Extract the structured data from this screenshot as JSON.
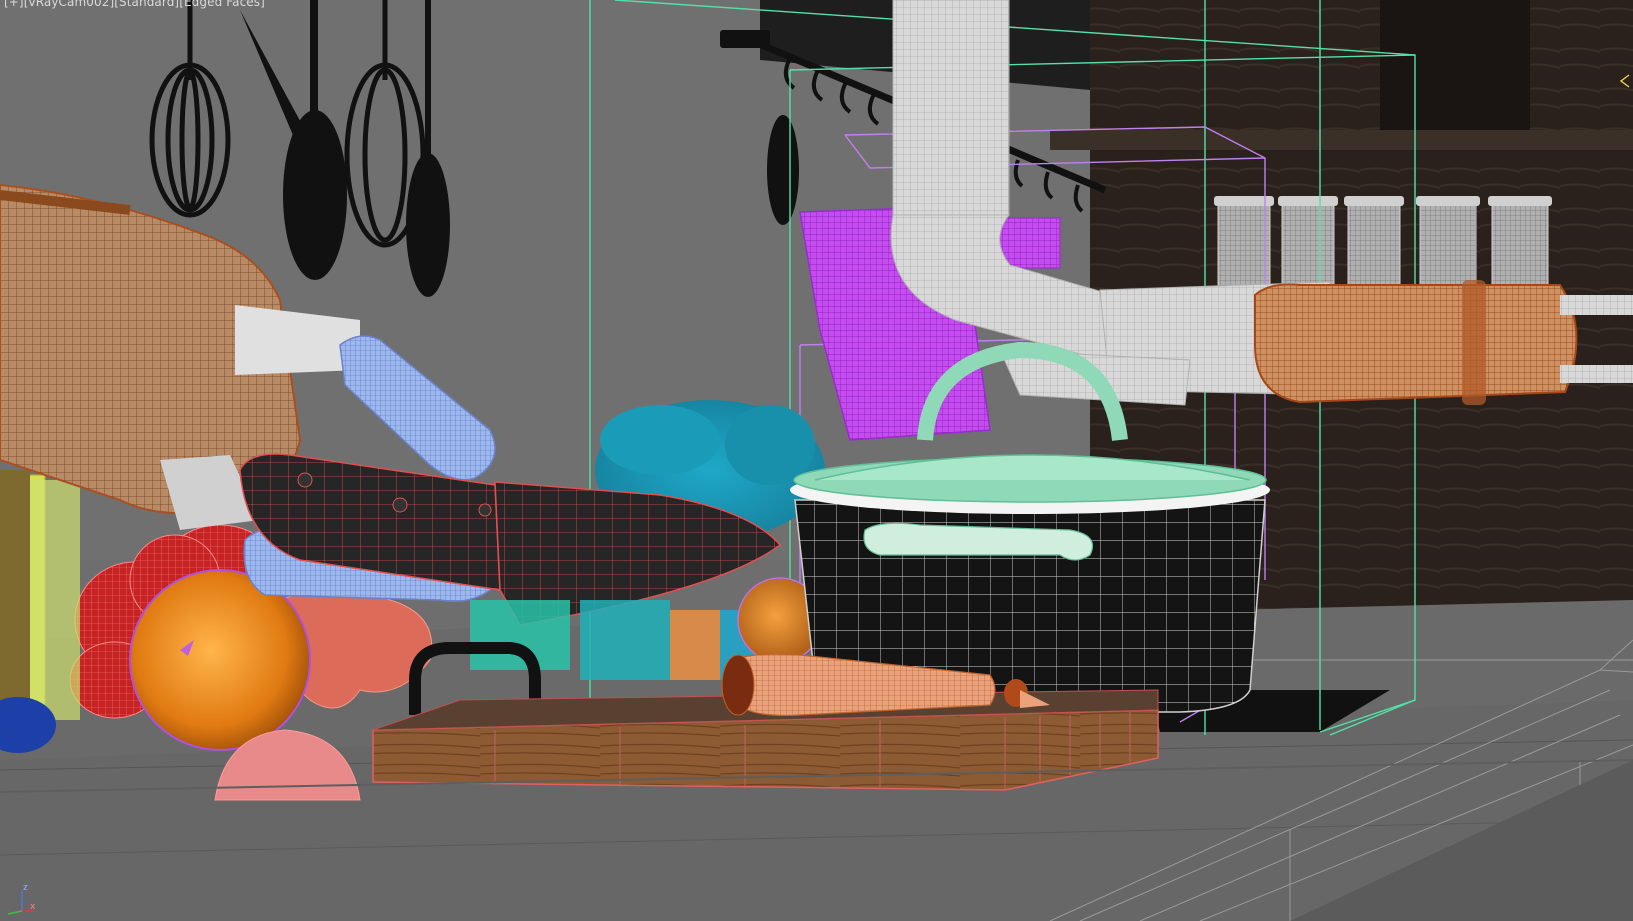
{
  "viewport": {
    "label_parts": [
      "[+]",
      "[vRayCam002]",
      "[Standard]",
      "[Edged Faces]"
    ],
    "active_border_color": "#e6d84a",
    "background_color": "#6b6b6b"
  },
  "axis_tripod": {
    "x_label": "x",
    "z_label": "z",
    "x_color": "#d04040",
    "z_color": "#4a7ad0",
    "y_color": "#3fbf3f"
  },
  "scene_objects": {
    "hanging_utensils": [
      "whisk",
      "ladle",
      "whisk",
      "spoon"
    ],
    "items": [
      "pepper grinder",
      "knife block",
      "chef knife",
      "tomatoes",
      "orange",
      "lettuce",
      "cutting board",
      "carrot",
      "stock pot",
      "faucet",
      "spice jars",
      "utensil holder"
    ],
    "colors": {
      "knife_block_wire": "#c06a2a",
      "knife_wire": "#e05050",
      "knife_handle_blue": "#9ab8f0",
      "pot_wire": "#7fe0b0",
      "utensil_holder": "#c040f0",
      "lettuce": "#20a0c0",
      "tomato": "#cc2a2a",
      "orange": "#e88a20",
      "cutting_board": "#8a5a32",
      "bbox_green": "#50e0a0",
      "bbox_purple": "#c080f0",
      "faucet": "#e4e4e4"
    }
  }
}
